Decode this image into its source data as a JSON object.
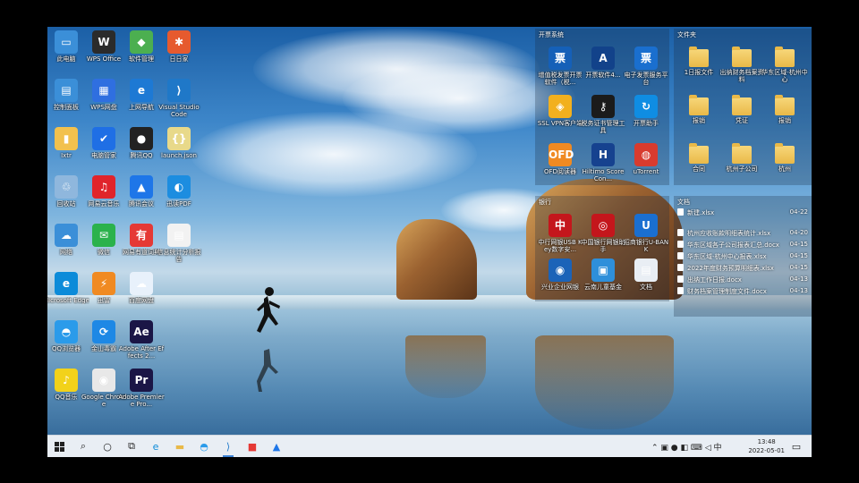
{
  "desktop": {
    "left_icons": [
      {
        "label": "此电脑",
        "color": "#3b8fd8",
        "glyph": "▭",
        "name": "this-pc-icon"
      },
      {
        "label": "WPS Office",
        "color": "#2b2b2b",
        "glyph": "W",
        "name": "wps-office-icon"
      },
      {
        "label": "软件管理",
        "color": "#4caf50",
        "glyph": "◆",
        "name": "software-manager-icon"
      },
      {
        "label": "日日家",
        "color": "#e65a2e",
        "glyph": "✱",
        "name": "app-icon"
      },
      {
        "label": "控制面板",
        "color": "#3b8fd8",
        "glyph": "▤",
        "name": "control-panel-icon"
      },
      {
        "label": "WPS网盘",
        "color": "#2f6fe0",
        "glyph": "▦",
        "name": "wps-cloud-icon"
      },
      {
        "label": "上网导航",
        "color": "#1d79d4",
        "glyph": "e",
        "name": "edge-nav-icon"
      },
      {
        "label": "Visual Studio Code",
        "color": "#1f78c8",
        "glyph": "⟩",
        "name": "vscode-icon"
      },
      {
        "label": "Ixtr",
        "color": "#f2c14e",
        "glyph": "▮",
        "name": "user-folder-icon"
      },
      {
        "label": "电脑管家",
        "color": "#1f6fe5",
        "glyph": "✔",
        "name": "pc-manager-icon"
      },
      {
        "label": "腾讯QQ",
        "color": "#222",
        "glyph": "●",
        "name": "qq-icon"
      },
      {
        "label": "launch.json",
        "color": "#e8d98a",
        "glyph": "{}",
        "name": "json-file-icon"
      },
      {
        "label": "回收站",
        "color": "#8fb7dd",
        "glyph": "♲",
        "name": "recycle-bin-icon"
      },
      {
        "label": "网易云音乐",
        "color": "#e0242b",
        "glyph": "♫",
        "name": "netease-music-icon"
      },
      {
        "label": "腾讯会议",
        "color": "#1e76e8",
        "glyph": "▲",
        "name": "tencent-meeting-icon"
      },
      {
        "label": "迅读PDF",
        "color": "#1c8de0",
        "glyph": "◐",
        "name": "pdf-reader-icon"
      },
      {
        "label": "网络",
        "color": "#3b8fd8",
        "glyph": "☁",
        "name": "network-icon"
      },
      {
        "label": "微信",
        "color": "#2bb24c",
        "glyph": "✉",
        "name": "wechat-icon"
      },
      {
        "label": "网易有道词典",
        "color": "#e53935",
        "glyph": "有",
        "name": "youdao-icon"
      },
      {
        "label": "信息统计分析报告",
        "color": "#f2f2f2",
        "glyph": "▤",
        "name": "document-icon"
      },
      {
        "label": "Microsoft Edge",
        "color": "#0c8bd9",
        "glyph": "e",
        "name": "edge-icon"
      },
      {
        "label": "迅雷",
        "color": "#f08a22",
        "glyph": "⚡",
        "name": "xunlei-icon"
      },
      {
        "label": "百度网盘",
        "color": "#e8f1fb",
        "glyph": "☁",
        "name": "baidu-pan-icon"
      },
      {
        "label": "",
        "color": "transparent",
        "glyph": "",
        "name": "empty-slot"
      },
      {
        "label": "QQ浏览器",
        "color": "#2b9bea",
        "glyph": "◓",
        "name": "qq-browser-icon"
      },
      {
        "label": "金山毒霸",
        "color": "#1e88e5",
        "glyph": "⟳",
        "name": "antivirus-icon"
      },
      {
        "label": "Adobe After Effects 2...",
        "color": "#1b1646",
        "glyph": "Ae",
        "name": "after-effects-icon"
      },
      {
        "label": "",
        "color": "transparent",
        "glyph": "",
        "name": "empty-slot"
      },
      {
        "label": "QQ音乐",
        "color": "#f2d21a",
        "glyph": "♪",
        "name": "qq-music-icon"
      },
      {
        "label": "Google Chrome",
        "color": "#e8e8e8",
        "glyph": "◉",
        "name": "chrome-icon"
      },
      {
        "label": "Adobe Premiere Pro...",
        "color": "#1b1646",
        "glyph": "Pr",
        "name": "premiere-pro-icon"
      }
    ],
    "fence_apps": {
      "title": "开票系统",
      "items": [
        {
          "label": "增值税发票开票软件（税...",
          "color": "#1560b8",
          "glyph": "票",
          "name": "invoice-software-icon"
        },
        {
          "label": "开票软件4...",
          "color": "#12428a",
          "glyph": "A",
          "name": "invoice-app-icon"
        },
        {
          "label": "电子发票服务平台",
          "color": "#1a6fcf",
          "glyph": "票",
          "name": "e-invoice-icon"
        },
        {
          "label": "SSL VPN客户端",
          "color": "#f2b01e",
          "glyph": "◈",
          "name": "vpn-icon"
        },
        {
          "label": "税务证书管理工具",
          "color": "#1b1b1b",
          "glyph": "⚷",
          "name": "certificate-icon"
        },
        {
          "label": "开票助手",
          "color": "#0f8de3",
          "glyph": "↻",
          "name": "invoice-helper-icon"
        },
        {
          "label": "OFD阅读器",
          "color": "#f08a22",
          "glyph": "OFD",
          "name": "ofd-reader-icon"
        },
        {
          "label": "Hiltimo Score Con...",
          "color": "#16428f",
          "glyph": "H",
          "name": "hiltimo-icon"
        },
        {
          "label": "uTorrent",
          "color": "#d83b2e",
          "glyph": "◍",
          "name": "torrent-icon"
        }
      ]
    },
    "fence_files": {
      "title": "文件夹",
      "items": [
        {
          "label": "1日报文件",
          "name": "folder-icon"
        },
        {
          "label": "出纳财务档案资料",
          "name": "folder-icon"
        },
        {
          "label": "华东区域-杭州中心",
          "name": "folder-icon"
        },
        {
          "label": "报销",
          "name": "folder-icon"
        },
        {
          "label": "凭证",
          "name": "folder-icon"
        },
        {
          "label": "报销",
          "name": "folder-icon"
        },
        {
          "label": "合同",
          "name": "folder-icon"
        },
        {
          "label": "杭州子公司",
          "name": "folder-icon"
        },
        {
          "label": "杭州",
          "name": "folder-icon"
        }
      ]
    },
    "fence_bank": {
      "title": "银行",
      "items": [
        {
          "label": "中行网银USB Key数字安...",
          "color": "#c4161c",
          "glyph": "中",
          "name": "boc-key-icon"
        },
        {
          "label": "中国银行网银助手",
          "color": "#c4161c",
          "glyph": "◎",
          "name": "boc-helper-icon"
        },
        {
          "label": "招商银行U-BANK",
          "color": "#1a6fd1",
          "glyph": "U",
          "name": "ubank-icon"
        },
        {
          "label": "兴业企业网银",
          "color": "#1b63b8",
          "glyph": "◉",
          "name": "cib-bank-icon"
        },
        {
          "label": "云南儿童基金",
          "color": "#2e8fda",
          "glyph": "▣",
          "name": "fund-icon"
        },
        {
          "label": "文档",
          "color": "#e9eef4",
          "glyph": "▤",
          "name": "docs-icon"
        }
      ]
    },
    "fence_docs": {
      "title": "文档",
      "items": [
        {
          "label": "新建.xlsx",
          "date": "04-22"
        },
        {
          "label": "杭州应收账款明细表统计.xlsx",
          "date": "04-20"
        },
        {
          "label": "华东区域各子公司报表汇总.docx",
          "date": "04-15"
        },
        {
          "label": "华东区域-杭州中心报表.xlsx",
          "date": "04-15"
        },
        {
          "label": "2022年度财务预算明细表.xlsx",
          "date": "04-15"
        },
        {
          "label": "出纳工作日报.docx",
          "date": "04-13"
        },
        {
          "label": "财务档案管理制度文件.docx",
          "date": "04-13"
        }
      ]
    }
  },
  "taskbar": {
    "start_icon": "windows-start-icon",
    "tray_glyphs": "⌃ ▣ ● ◧ ⌨ ◁ 中",
    "time": "13:48",
    "date": "2022-05-01"
  }
}
